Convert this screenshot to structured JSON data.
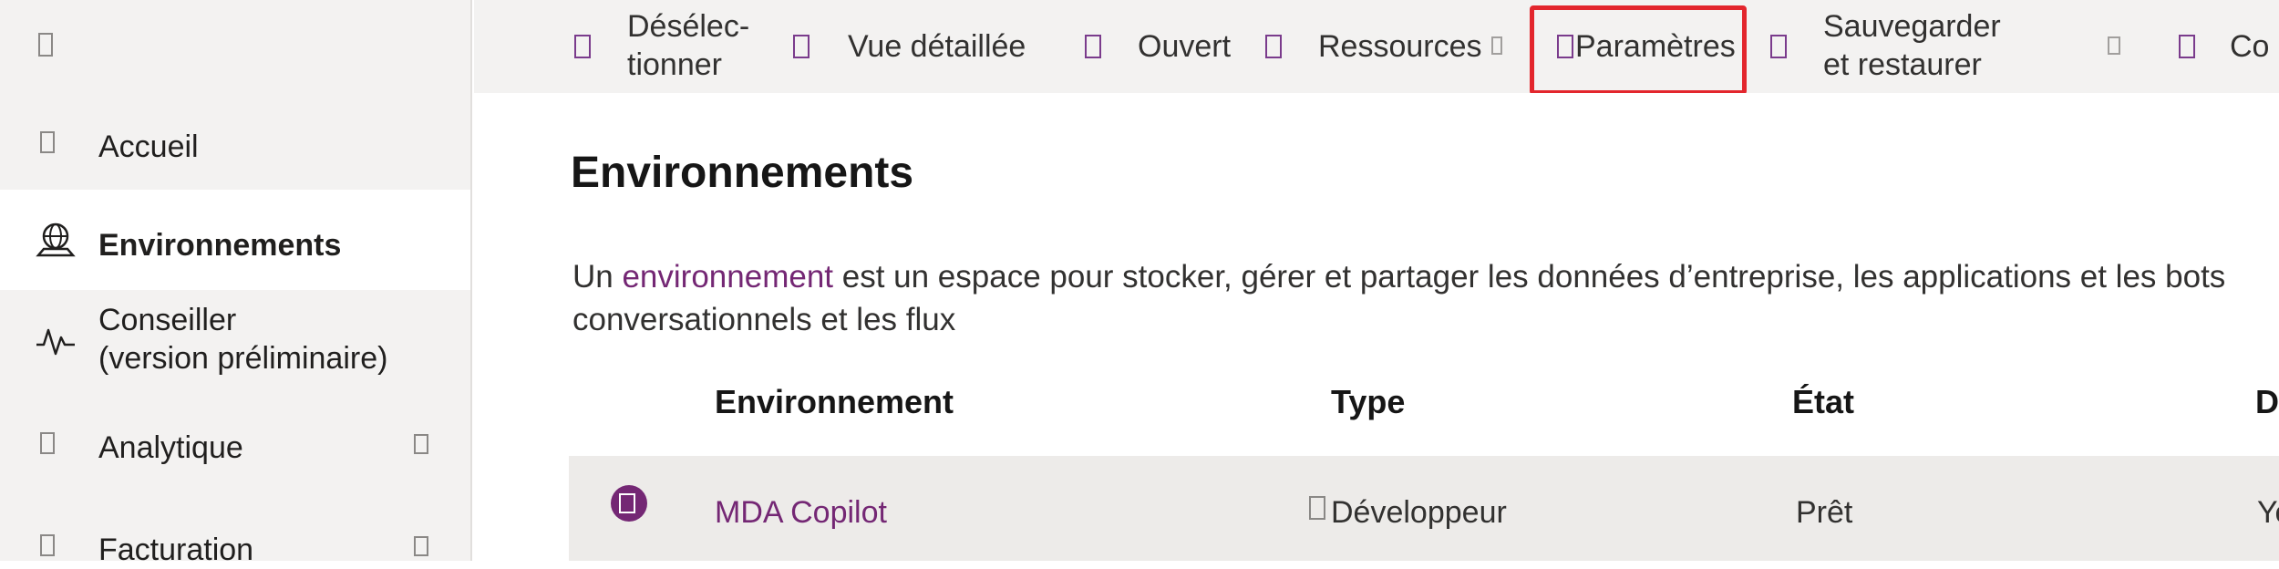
{
  "sidebar": {
    "items": [
      {
        "label": "Accueil",
        "icon": "home-icon"
      },
      {
        "label": "Environnements",
        "icon": "globe-icon",
        "active": true
      },
      {
        "label": "Conseiller\n(version préliminaire)",
        "icon": "pulse-icon"
      },
      {
        "label": "Analytique",
        "icon": "analytics-icon"
      },
      {
        "label": "Facturation",
        "icon": "billing-icon"
      }
    ]
  },
  "commandbar": {
    "items": [
      {
        "label": "Désélec-\ntionner",
        "icon": "deselect-icon"
      },
      {
        "label": "Vue détaillée",
        "icon": "details-icon"
      },
      {
        "label": "Ouvert",
        "icon": "open-icon"
      },
      {
        "label": "Ressources",
        "icon": "resources-icon"
      },
      {
        "label": "Paramètres",
        "icon": "settings-icon",
        "highlighted": true
      },
      {
        "label": "Sauvegarder\net restaurer",
        "icon": "backup-icon"
      },
      {
        "label": "Co",
        "icon": "copy-icon"
      }
    ]
  },
  "main": {
    "title": "Environnements",
    "description_pre": "Un ",
    "description_link": "environnement",
    "description_post": " est un espace pour stocker, gérer et partager les données d’entreprise, les applications et les bots conversationnels et les flux",
    "columns": [
      "Environnement",
      "Type",
      "État",
      "D"
    ],
    "rows": [
      {
        "name": "MDA Copilot",
        "type": "Développeur",
        "state": "Prêt",
        "extra": "Ye"
      }
    ]
  },
  "colors": {
    "accent": "#742774",
    "highlight": "#e3262d",
    "sidebar_bg": "#f3f2f1"
  }
}
